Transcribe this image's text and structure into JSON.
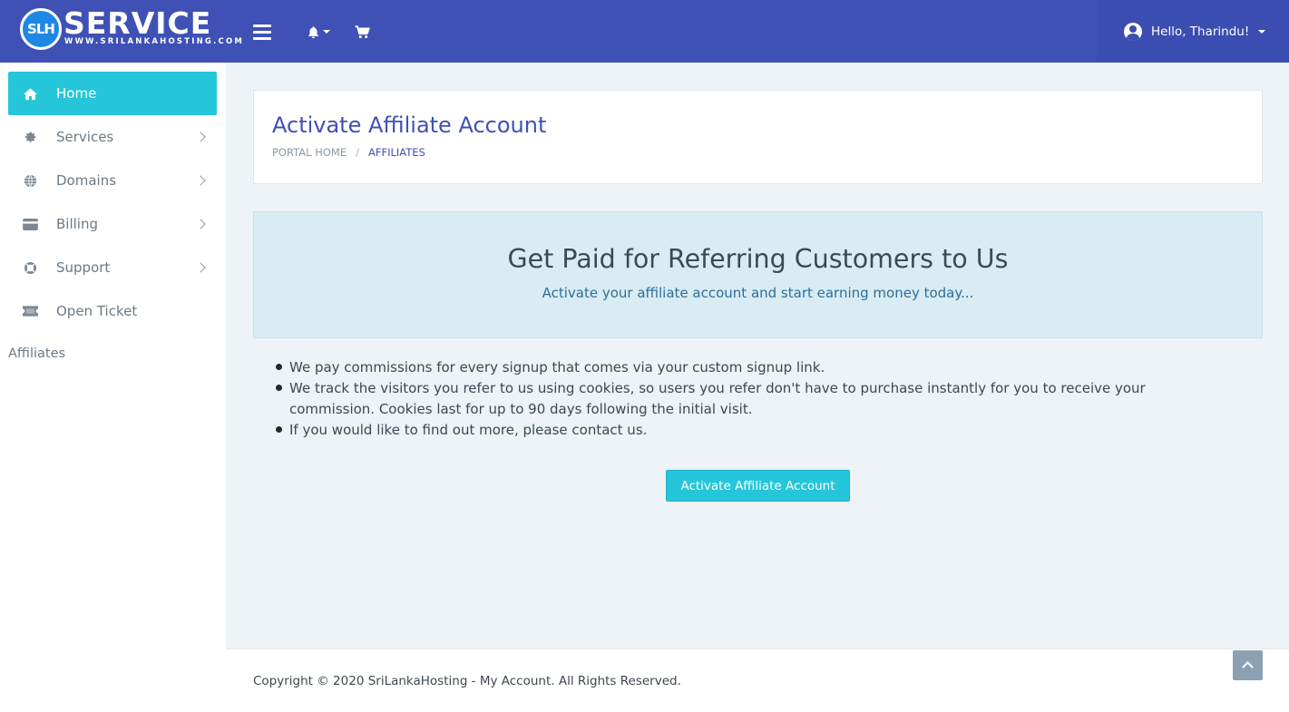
{
  "brand": {
    "logo_mark": "SLH",
    "logo_word": "SERVICE",
    "logo_url": "WWW.SRILANKAHOSTING.COM"
  },
  "navbar": {
    "menu_icon": "hamburger-icon",
    "notifications_icon": "bell-icon",
    "cart_icon": "shopping-cart-icon",
    "user_greeting": "Hello, Tharindu!",
    "user_icon": "user-circle-icon"
  },
  "sidebar": {
    "items": [
      {
        "label": "Home",
        "icon": "home-icon",
        "active": true,
        "has_children": false
      },
      {
        "label": "Services",
        "icon": "gear-icon",
        "active": false,
        "has_children": true
      },
      {
        "label": "Domains",
        "icon": "globe-icon",
        "active": false,
        "has_children": true
      },
      {
        "label": "Billing",
        "icon": "credit-card-icon",
        "active": false,
        "has_children": true
      },
      {
        "label": "Support",
        "icon": "life-ring-icon",
        "active": false,
        "has_children": true
      },
      {
        "label": "Open Ticket",
        "icon": "ticket-icon",
        "active": false,
        "has_children": false
      }
    ],
    "section_heading": "Affiliates"
  },
  "page": {
    "title": "Activate Affiliate Account",
    "breadcrumb": {
      "home": "PORTAL HOME",
      "separator": "/",
      "current": "AFFILIATES"
    }
  },
  "hero": {
    "title": "Get Paid for Referring Customers to Us",
    "subtitle": "Activate your affiliate account and start earning money today..."
  },
  "bullets": [
    "We pay commissions for every signup that comes via your custom signup link.",
    "We track the visitors you refer to us using cookies, so users you refer don't have to purchase instantly for you to receive your commission. Cookies last for up to 90 days following the initial visit.",
    "If you would like to find out more, please contact us."
  ],
  "actions": {
    "activate_button": "Activate Affiliate Account"
  },
  "footer": {
    "copyright": "Copyright © 2020 SriLankaHosting - My Account. All Rights Reserved.",
    "back_to_top_icon": "chevron-up-icon"
  },
  "colors": {
    "navbar": "#3f51b5",
    "accent": "#26c6da",
    "hero_bg": "#d9ecf4",
    "page_bg": "#edf3f7"
  }
}
